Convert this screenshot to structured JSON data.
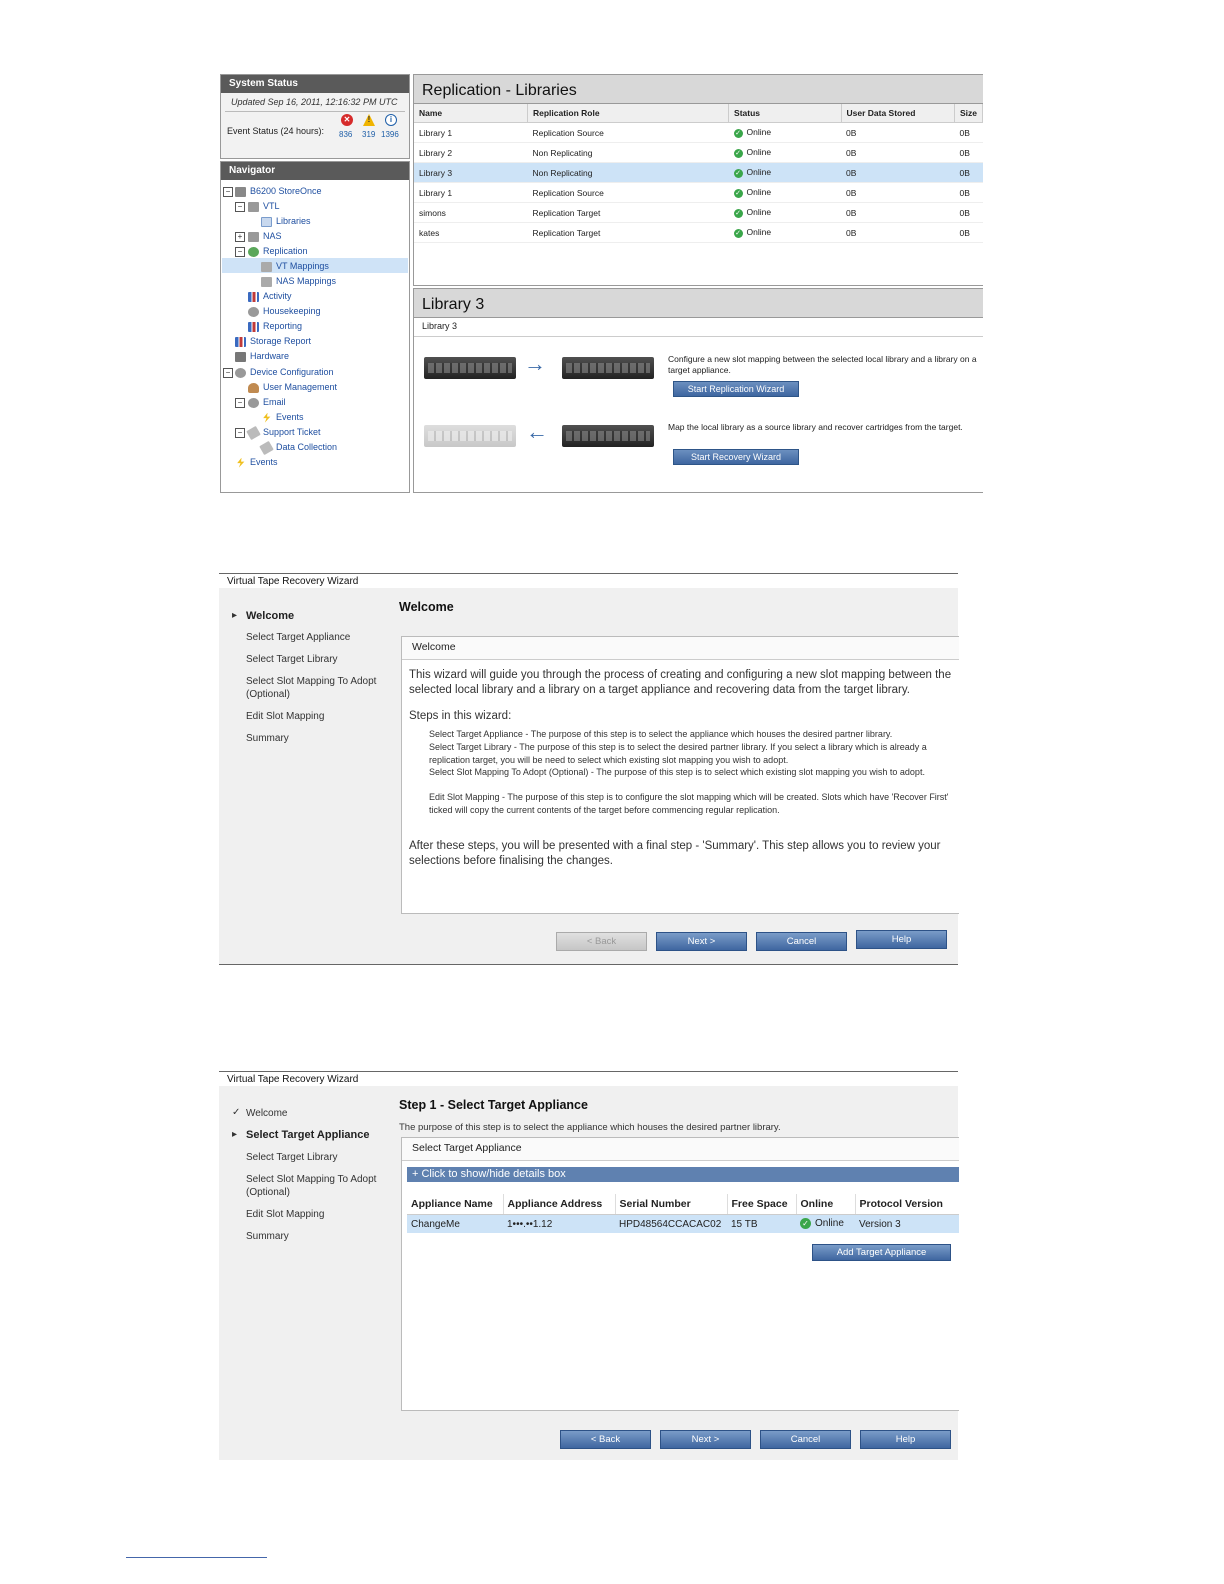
{
  "shot1": {
    "system_status": {
      "title": "System Status",
      "updated": "Updated Sep 16, 2011, 12:16:32 PM UTC",
      "event_label": "Event Status (24 hours):",
      "counts": {
        "error": "836",
        "warning": "319",
        "info": "1396"
      }
    },
    "navigator": {
      "title": "Navigator",
      "items": [
        "B6200 StoreOnce",
        "VTL",
        "Libraries",
        "NAS",
        "Replication",
        "VT Mappings",
        "NAS Mappings",
        "Activity",
        "Housekeeping",
        "Reporting",
        "Storage Report",
        "Hardware",
        "Device Configuration",
        "User Management",
        "Email",
        "Events",
        "Support Ticket",
        "Data Collection",
        "Events"
      ]
    },
    "replication": {
      "title": "Replication - Libraries",
      "columns": [
        "Name",
        "Replication Role",
        "Status",
        "User Data Stored",
        "Size"
      ],
      "rows": [
        [
          "Library 1",
          "Replication Source",
          "Online",
          "0B",
          "0B"
        ],
        [
          "Library 2",
          "Non Replicating",
          "Online",
          "0B",
          "0B"
        ],
        [
          "Library 3",
          "Non Replicating",
          "Online",
          "0B",
          "0B"
        ],
        [
          "Library 1",
          "Replication Source",
          "Online",
          "0B",
          "0B"
        ],
        [
          "simons",
          "Replication Target",
          "Online",
          "0B",
          "0B"
        ],
        [
          "kates",
          "Replication Target",
          "Online",
          "0B",
          "0B"
        ]
      ]
    },
    "library": {
      "title": "Library 3",
      "subtitle": "Library 3",
      "replicate_text": "Configure a new slot mapping between the selected local library and a library on a target appliance.",
      "replicate_button": "Start Replication Wizard",
      "recover_text": "Map the local library as a source library and recover cartridges from the target.",
      "recover_button": "Start Recovery Wizard"
    }
  },
  "wizard": {
    "title": "Virtual Tape Recovery Wizard",
    "steps": [
      "Welcome",
      "Select Target Appliance",
      "Select Target Library",
      "Select Slot Mapping To Adopt (Optional)",
      "Edit Slot Mapping",
      "Summary"
    ],
    "buttons": {
      "back": "< Back",
      "next": "Next >",
      "cancel": "Cancel",
      "help": "Help"
    }
  },
  "welcome_page": {
    "title": "Welcome",
    "box_head": "Welcome",
    "intro": "This wizard will guide you through the process of creating and configuring a new slot mapping between the selected local library and a library on a target appliance and recovering data from the target library.",
    "steps_label": "Steps in this wizard:",
    "step_desc": [
      "Select Target Appliance - The purpose of this step is to select the appliance which houses the desired partner library.",
      "Select Target Library - The purpose of this step is to select the desired partner library. If you select a library which is already a replication target, you will be need to select which existing slot mapping you wish to adopt.",
      "Select Slot Mapping To Adopt (Optional) - The purpose of this step is to select which existing slot mapping you wish to adopt.",
      "Edit Slot Mapping - The purpose of this step is to configure the slot mapping which will be created. Slots which have 'Recover First' ticked will copy the current contents of the target before commencing regular replication."
    ],
    "outro": "After these steps, you will be presented with a final step - 'Summary'. This step allows you to review your selections before finalising the changes."
  },
  "step1_page": {
    "title": "Step 1 - Select Target Appliance",
    "purpose": "The purpose of this step is to select the appliance which houses the desired partner library.",
    "box_head": "Select Target Appliance",
    "details_toggle": "+ Click to show/hide details box",
    "columns": [
      "Appliance Name",
      "Appliance Address",
      "Serial Number",
      "Free Space",
      "Online",
      "Protocol Version"
    ],
    "row": [
      "ChangeMe",
      "1•••.••1.12",
      "HPD48564CCACAC02",
      "15 TB",
      "Online",
      "Version 3"
    ],
    "add_button": "Add Target Appliance"
  },
  "colors": {
    "accent": "#3e66a0",
    "selection": "#cde3f7",
    "ok": "#3aa64a",
    "error": "#d62b2b",
    "warning": "#f0b400"
  }
}
